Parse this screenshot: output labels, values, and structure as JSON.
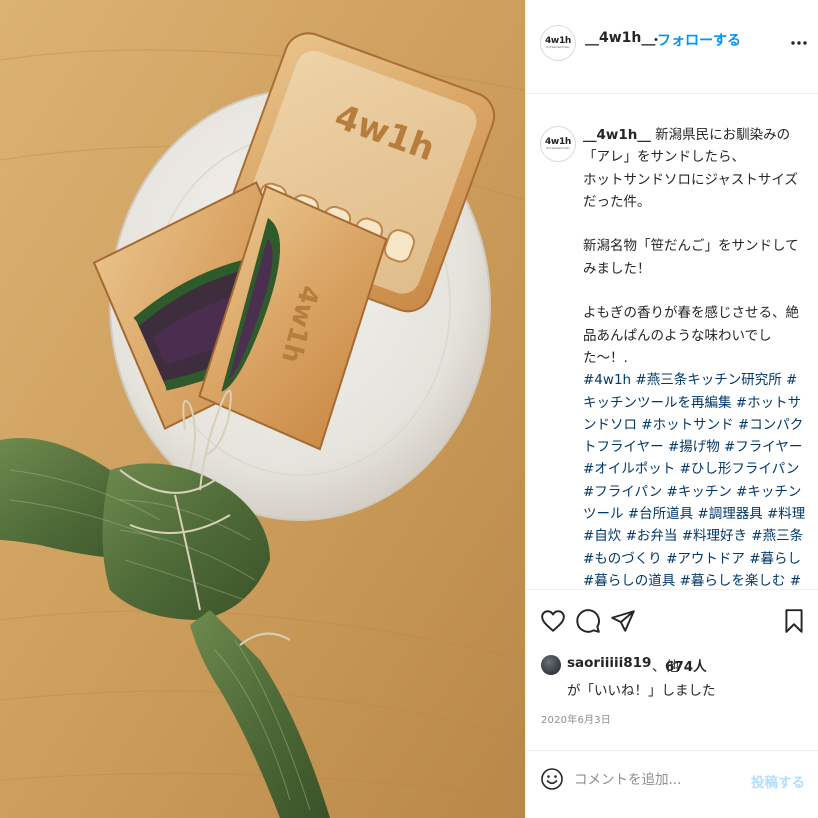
{
  "photo": {
    "stamp_text": "4w1h"
  },
  "header": {
    "avatar_logo": "4w1h",
    "avatar_sub": "Hot Sandwich Solo",
    "username": "__4w1h__",
    "dot": "・",
    "follow_label": "フォローする",
    "more_icon": "more-horizontal-icon"
  },
  "caption": {
    "avatar_logo": "4w1h",
    "username": "__4w1h__",
    "text_1": " 新潟県民にお馴染みの「アレ」をサンドしたら、\nホットサンドソロにジャストサイズだった件。\n\n新潟名物「笹だんご」をサンドしてみました！\n\nよもぎの香りが春を感じさせる、絶品あんぱんのような味わいでした〜！.\n",
    "hashtags": "#4w1h #燕三条キッチン研究所 #キッチンツールを再編集 #ホットサンドソロ #ホットサンド #コンパクトフライヤー #揚げ物 #フライヤー #オイルポット #ひし形フライパン #フライパン #キッチン #キッチンツール #台所道具 #調理器具 #料理 #自炊 #お弁当 #料理好き #燕三条 #ものづくり #アウトドア #暮らし #暮らしの道具 #暮らしを楽しむ #ごはん #"
  },
  "actions": {
    "like_icon": "heart-icon",
    "comment_icon": "comment-icon",
    "share_icon": "share-icon",
    "save_icon": "bookmark-icon"
  },
  "likes": {
    "user": "saoriiiii819",
    "sep": "、他",
    "count": "674人",
    "line2": "が「いいね！」しました"
  },
  "date": "2020年6月3日",
  "comment": {
    "placeholder": "コメントを追加...",
    "post_label": "投稿する",
    "emoji_icon": "smiley-icon"
  }
}
